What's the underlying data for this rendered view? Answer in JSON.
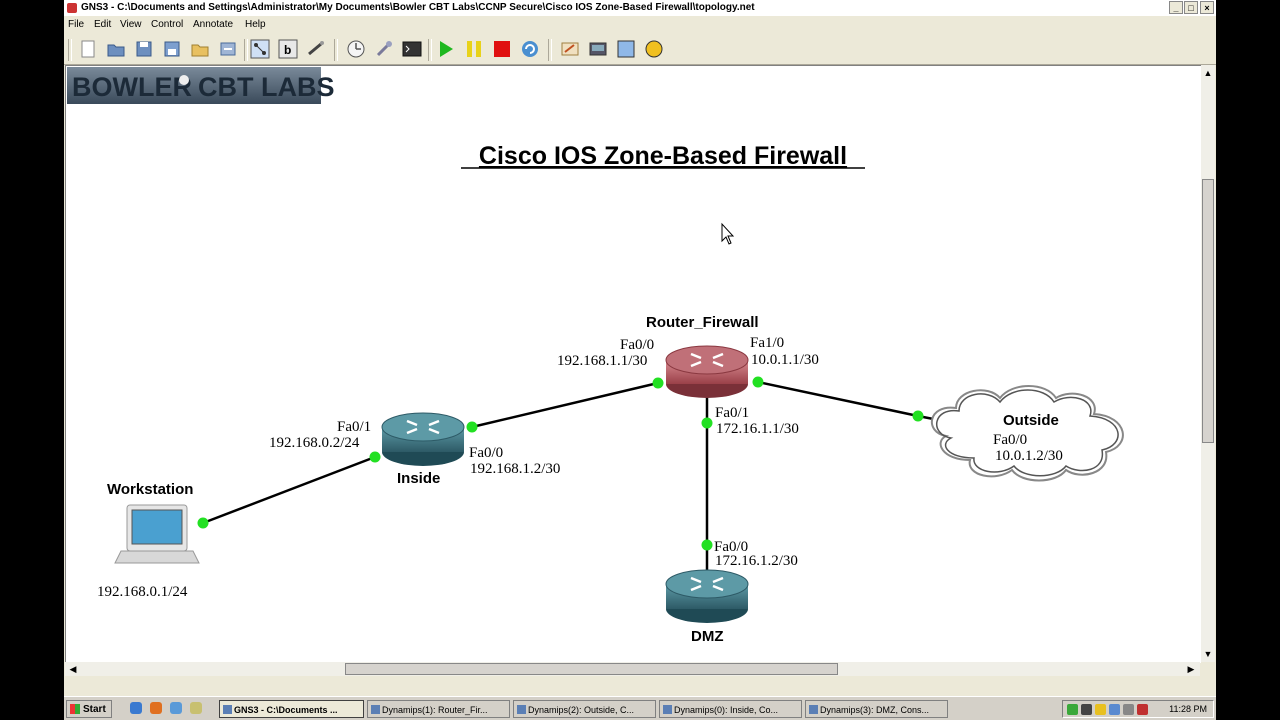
{
  "window": {
    "title": "GNS3 - C:\\Documents and Settings\\Administrator\\My Documents\\Bowler CBT Labs\\CCNP Secure\\Cisco IOS Zone-Based Firewall\\topology.net",
    "controls": {
      "minimize": "_",
      "maximize": "□",
      "close": "×"
    }
  },
  "menu": [
    "File",
    "Edit",
    "View",
    "Control",
    "Annotate",
    "Help"
  ],
  "toolbar": {
    "groups": [
      [
        "new-icon",
        "open-icon",
        "save-icon",
        "save-as-icon",
        "open-project-icon",
        "export-icon"
      ],
      [
        "show-interface-labels-icon",
        "show-hostnames-icon",
        "add-link-icon"
      ],
      [
        "idle-pc-icon",
        "configure-icon",
        "console-icon"
      ],
      [
        "start-icon",
        "suspend-icon",
        "stop-icon",
        "reload-icon"
      ],
      [
        "annotate-icon",
        "screenshot-icon",
        "draw-rectangle-icon",
        "draw-ellipse-icon"
      ]
    ],
    "colors": {
      "start": "#1fb81f",
      "suspend": "#e8d21a",
      "stop": "#e01010",
      "reload": "#4a8fd0",
      "rectangle": "#8fb8e8",
      "ellipse": "#f0c020"
    }
  },
  "logo": {
    "left": "BOWLER",
    "right": "CBT LABS"
  },
  "diagram": {
    "title": "Cisco IOS Zone-Based Firewall",
    "nodes": {
      "router_firewall": {
        "name": "Router_Firewall"
      },
      "inside": {
        "name": "Inside"
      },
      "dmz": {
        "name": "DMZ"
      },
      "outside": {
        "name": "Outside"
      },
      "workstation": {
        "name": "Workstation",
        "ip": "192.168.0.1/24"
      }
    },
    "interfaces": {
      "rf_fa00": {
        "name": "Fa0/0",
        "ip": "192.168.1.1/30"
      },
      "rf_fa10": {
        "name": "Fa1/0",
        "ip": "10.0.1.1/30"
      },
      "rf_fa01": {
        "name": "Fa0/1",
        "ip": "172.16.1.1/30"
      },
      "in_fa01": {
        "name": "Fa0/1",
        "ip": "192.168.0.2/24"
      },
      "in_fa00": {
        "name": "Fa0/0",
        "ip": "192.168.1.2/30"
      },
      "dmz_fa00": {
        "name": "Fa0/0",
        "ip": "172.16.1.2/30"
      },
      "out_fa00": {
        "name": "Fa0/0",
        "ip": "10.0.1.2/30"
      }
    },
    "router_colors": {
      "firewall": "#b65a62",
      "standard": "#3d7a86"
    },
    "link_up_color": "#22e022"
  },
  "taskbar": {
    "start": "Start",
    "tasks": [
      {
        "label": "GNS3 - C:\\Documents ...",
        "active": true
      },
      {
        "label": "Dynamips(1): Router_Fir..."
      },
      {
        "label": "Dynamips(2): Outside, C..."
      },
      {
        "label": "Dynamips(0): Inside, Co..."
      },
      {
        "label": "Dynamips(3): DMZ, Cons..."
      }
    ],
    "clock": "11:28 PM"
  }
}
